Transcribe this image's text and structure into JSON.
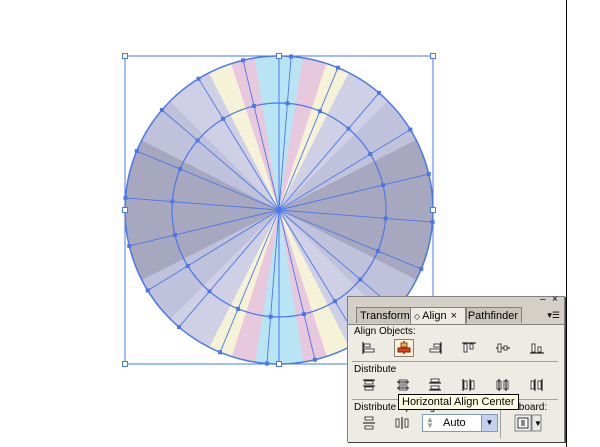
{
  "panel": {
    "tabs": [
      {
        "label": "Transform"
      },
      {
        "label": "Align",
        "active": true
      },
      {
        "label": "Pathfinder"
      }
    ],
    "sections": {
      "align_objects": "Align Objects:",
      "distribute_objects": "Distribute",
      "distribute_spacing": "Distribute Spacing:",
      "artboard": "Artboard:"
    },
    "tooltip": "Horizontal Align Center",
    "spacing_value": "Auto"
  },
  "colors": {
    "selection": "#4a78e8",
    "panel_bg": "#eeebe4",
    "tooltip_bg": "#ffffe1"
  }
}
